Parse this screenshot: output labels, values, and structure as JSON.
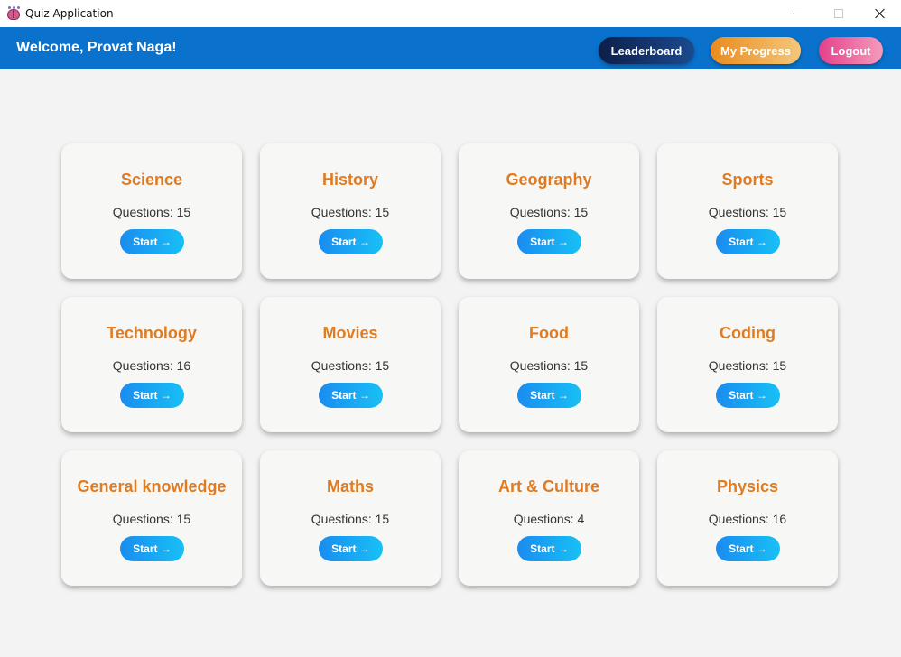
{
  "window": {
    "title": "Quiz Application",
    "icon": "brain-icon",
    "controls": [
      "minimize-icon",
      "maximize-icon",
      "close-icon"
    ]
  },
  "header": {
    "welcome": "Welcome, Provat Naga!",
    "buttons": {
      "leaderboard": "Leaderboard",
      "progress": "My Progress",
      "logout": "Logout"
    }
  },
  "quiz_prefix": "Questions: ",
  "start_label": "Start →",
  "categories": [
    {
      "name": "Science",
      "count": "15"
    },
    {
      "name": "History",
      "count": "15"
    },
    {
      "name": "Geography",
      "count": "15"
    },
    {
      "name": "Sports",
      "count": "15"
    },
    {
      "name": "Technology",
      "count": "16"
    },
    {
      "name": "Movies",
      "count": "15"
    },
    {
      "name": "Food",
      "count": "15"
    },
    {
      "name": "Coding",
      "count": "15"
    },
    {
      "name": "General knowledge",
      "count": "15"
    },
    {
      "name": "Maths",
      "count": "15"
    },
    {
      "name": "Art & Culture",
      "count": "4"
    },
    {
      "name": "Physics",
      "count": "16"
    }
  ],
  "colors": {
    "header": "#0a72cc",
    "card_title": "#e07b22",
    "start_button": "#1a8cf0"
  }
}
